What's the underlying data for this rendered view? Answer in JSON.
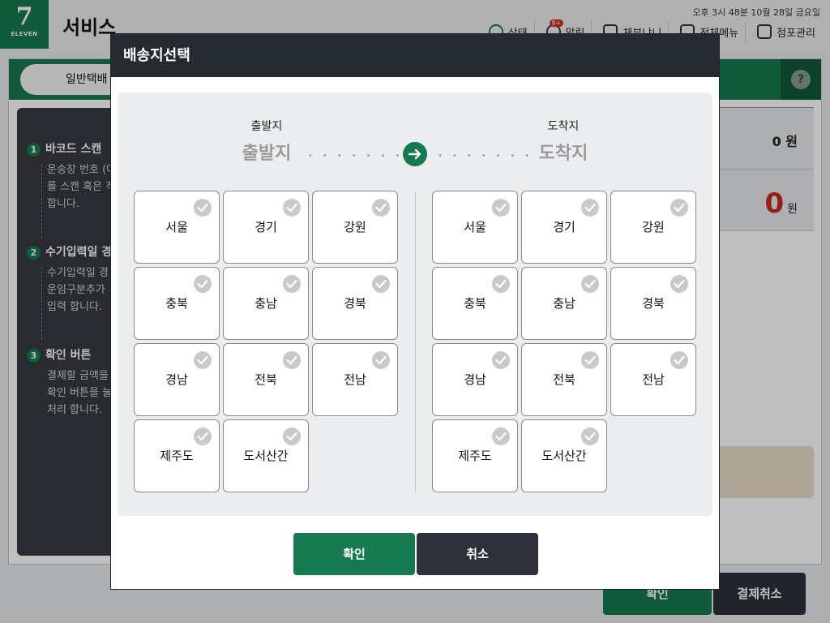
{
  "app": {
    "logo_text": "ELEVEN",
    "title": "서비스",
    "datetime": "오후 3시 48분  10월 28일 금요일",
    "menu": [
      {
        "label": "상태"
      },
      {
        "label": "알림",
        "badge": "9+"
      },
      {
        "label": "체부냐니"
      },
      {
        "label": "전체메뉴"
      },
      {
        "label": "점포관리"
      }
    ],
    "tab_label": "일반택배",
    "help_label": "?"
  },
  "guide": {
    "steps": [
      {
        "num": "1",
        "title": "바코드 스캔",
        "desc": "운송장 번호 (여\n를 스캔 혹은 직\n합니다."
      },
      {
        "num": "2",
        "title": "수기입력일 경",
        "desc": "수기입력일 경\n운임구분추가\n입력 합니다."
      },
      {
        "num": "3",
        "title": "확인 버튼",
        "desc": "결제할 금액을\n확인 버튼을 눌\n처리 합니다."
      }
    ]
  },
  "amounts": {
    "row1": "0 원",
    "row2_value": "0",
    "row2_unit": "원"
  },
  "background_buttons": {
    "confirm": "확인",
    "cancel": "결제취소"
  },
  "modal": {
    "title": "배송지선택",
    "origin_label": "출발지",
    "origin_value": "출발지",
    "dest_label": "도착지",
    "dest_value": "도착지",
    "origin_regions": [
      "서울",
      "경기",
      "강원",
      "충북",
      "충남",
      "경북",
      "경남",
      "전북",
      "전남",
      "제주도",
      "도서산간"
    ],
    "dest_regions": [
      "서울",
      "경기",
      "강원",
      "충북",
      "충남",
      "경북",
      "경남",
      "전북",
      "전남",
      "제주도",
      "도서산간"
    ],
    "confirm_label": "확인",
    "cancel_label": "취소"
  },
  "colors": {
    "brand_green": "#157a4f",
    "header_dark": "#262a31",
    "amount_red": "#c8291d"
  }
}
